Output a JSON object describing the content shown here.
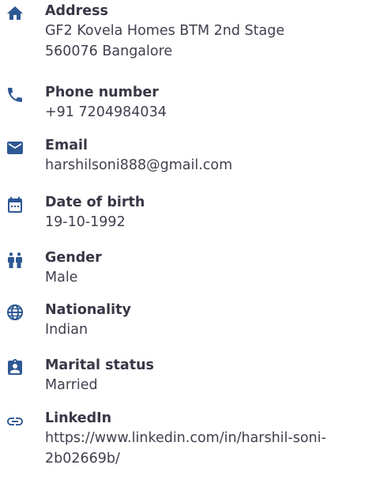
{
  "colors": {
    "icon": "#2e5894",
    "label": "#373746",
    "value": "#3f3f4e"
  },
  "items": [
    {
      "icon": "home-icon",
      "label": "Address",
      "lines": [
        "GF2 Kovela Homes BTM 2nd Stage",
        "560076 Bangalore"
      ]
    },
    {
      "icon": "phone-icon",
      "label": "Phone number",
      "lines": [
        "+91 7204984034"
      ]
    },
    {
      "icon": "mail-icon",
      "label": "Email",
      "lines": [
        "harshilsoni888@gmail.com"
      ]
    },
    {
      "icon": "calendar-icon",
      "label": "Date of birth",
      "lines": [
        "19-10-1992"
      ]
    },
    {
      "icon": "people-icon",
      "label": "Gender",
      "lines": [
        "Male"
      ]
    },
    {
      "icon": "globe-icon",
      "label": "Nationality",
      "lines": [
        "Indian"
      ]
    },
    {
      "icon": "id-badge-icon",
      "label": "Marital status",
      "lines": [
        "Married"
      ]
    },
    {
      "icon": "link-icon",
      "label": "LinkedIn",
      "lines": [
        "https://www.linkedin.com/in/harshil-soni-",
        "2b02669b/"
      ]
    }
  ]
}
